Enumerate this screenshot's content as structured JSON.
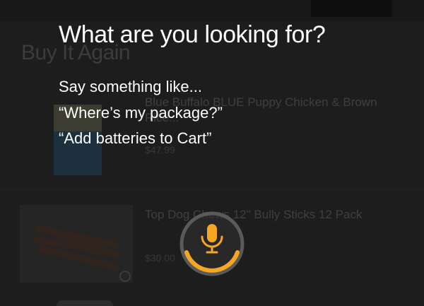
{
  "background_page": {
    "section_title": "Buy It Again",
    "items": [
      {
        "name": "Blue Buffalo BLUE Puppy Chicken & Brown Rice...",
        "price": "$47.99"
      },
      {
        "name": "Top Dog Chews 12\" Bully Sticks 12 Pack",
        "price": "$30.00"
      }
    ]
  },
  "voice_overlay": {
    "title": "What are you looking for?",
    "say_label": "Say something like...",
    "examples": [
      "“Where’s my package?”",
      "“Add batteries to Cart”"
    ],
    "mic_icon": "microphone-icon",
    "accent_color": "#f5a623"
  }
}
